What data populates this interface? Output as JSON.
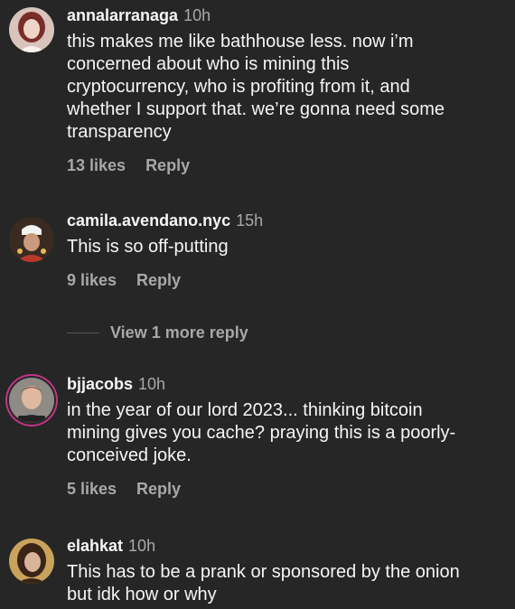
{
  "comments": [
    {
      "username": "annalarranaga",
      "time": "10h",
      "text": "this makes me like bathhouse less. now i’m\nconcerned about who is mining this\ncryptocurrency, who is profiting from it, and\nwhether I support that. we’re gonna need some\ntransparency",
      "likes": "13 likes",
      "reply": "Reply",
      "avatar_icon": "profile-photo-icon"
    },
    {
      "username": "camila.avendano.nyc",
      "time": "15h",
      "text": "This is so off-putting",
      "likes": "9 likes",
      "reply": "Reply",
      "avatar_icon": "profile-photo-icon"
    },
    {
      "username": "bjjacobs",
      "time": "10h",
      "text": "in the year of our lord 2023... thinking bitcoin\nmining gives you cache? praying this is a poorly-\nconceived joke.",
      "likes": "5 likes",
      "reply": "Reply",
      "avatar_icon": "profile-photo-icon"
    },
    {
      "username": "elahkat",
      "time": "10h",
      "text": "This has to be a prank or sponsored by the onion\nbut idk how or why",
      "likes": "",
      "reply": "",
      "avatar_icon": "profile-photo-icon"
    }
  ],
  "view_more_replies": "View 1 more reply",
  "colors": {
    "background": "#262626",
    "primary_text": "#f5f5f5",
    "secondary_text": "#a8a8a8",
    "story_ring": "#c13584"
  }
}
